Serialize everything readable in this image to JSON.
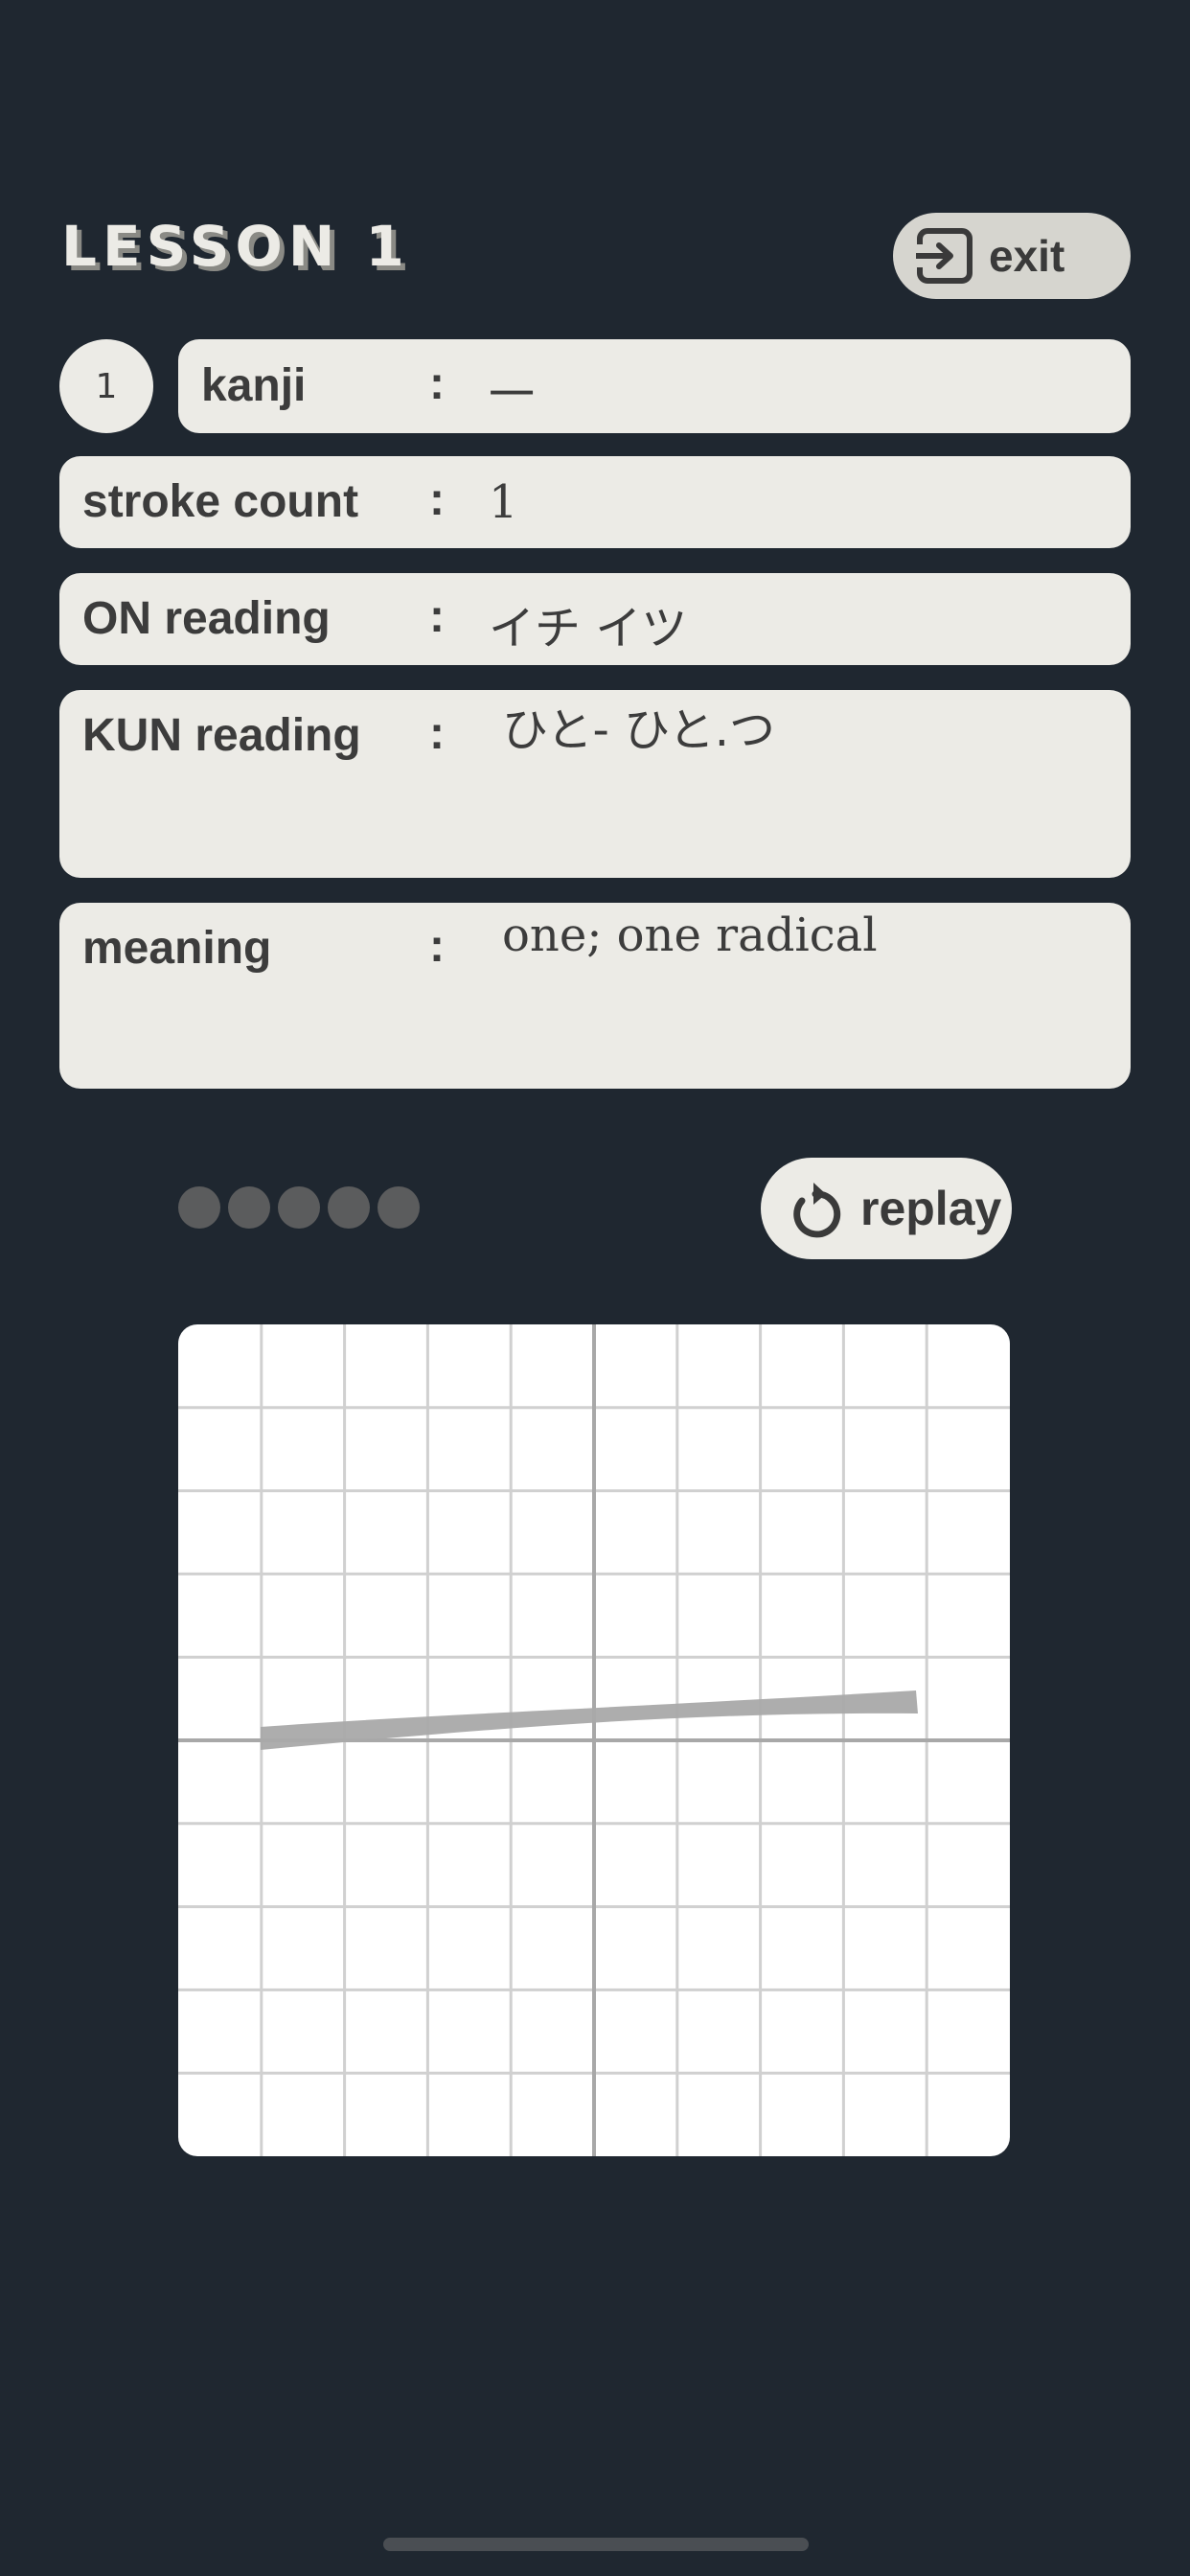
{
  "header": {
    "title": "LESSON 1",
    "exit_label": "exit"
  },
  "kanji_card": {
    "index": "1",
    "rows": [
      {
        "label": "kanji",
        "separator": ":",
        "value": "一"
      },
      {
        "label": "stroke count",
        "separator": ":",
        "value": "1"
      },
      {
        "label": "ON reading",
        "separator": ":",
        "value": "イチ イツ"
      },
      {
        "label": "KUN reading",
        "separator": ":",
        "value": "ひと- ひと.つ"
      },
      {
        "label": "meaning",
        "separator": ":",
        "value": "one; one radical"
      }
    ]
  },
  "stroke_player": {
    "replay_label": "replay"
  },
  "icons": {
    "exit": "exit-to-app-icon",
    "replay": "replay-icon"
  },
  "colors": {
    "background": "#1f2730",
    "card": "#ecebe6",
    "button": "#d6d5cf",
    "text": "#3c3c3c",
    "stroke": "#a9a9a9"
  }
}
